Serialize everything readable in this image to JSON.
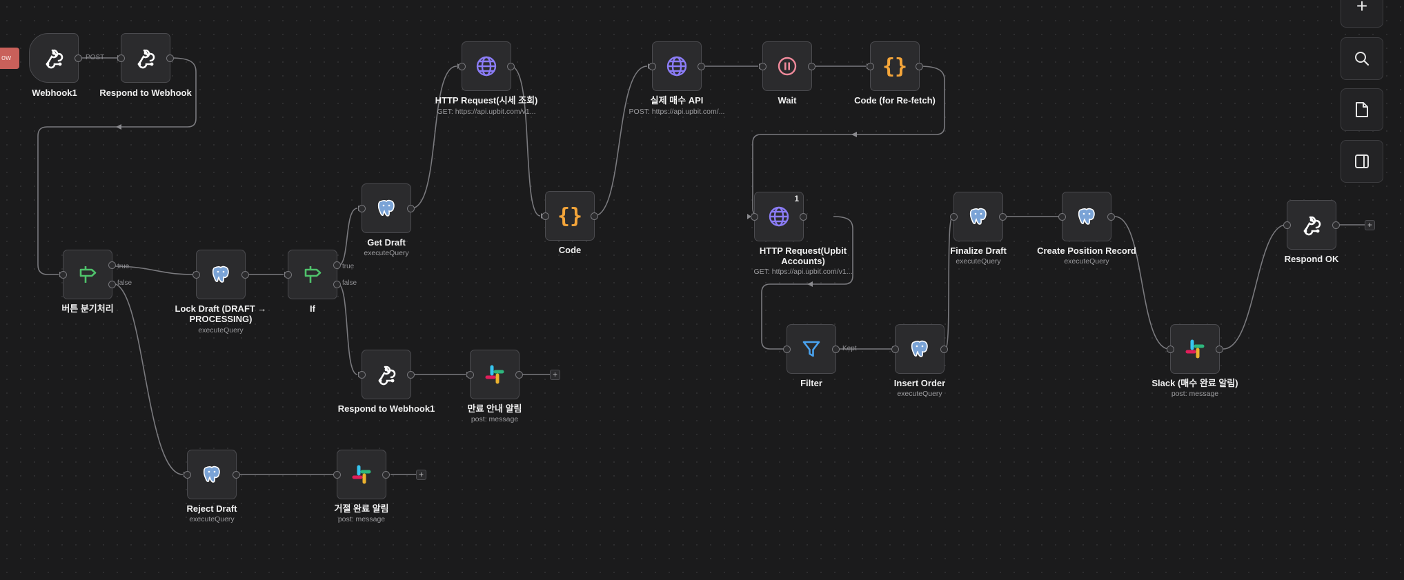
{
  "canvas": {
    "left_tag": "ow"
  },
  "side_controls": [
    {
      "icon": "plus-icon",
      "glyph": "+"
    },
    {
      "icon": "search-icon"
    },
    {
      "icon": "sticky-note-icon"
    },
    {
      "icon": "panel-toggle-icon"
    }
  ],
  "nodes": {
    "webhook1": {
      "label": "Webhook1",
      "icon": "webhook-icon"
    },
    "respond_webhook": {
      "label": "Respond to Webhook",
      "icon": "webhook-icon"
    },
    "http_price": {
      "label": "HTTP Request(시세 조회)",
      "sub": "GET: https://api.upbit.com/v1...",
      "icon": "globe-icon"
    },
    "buy_api": {
      "label": "실제 매수 API",
      "sub": "POST: https://api.upbit.com/...",
      "icon": "globe-icon"
    },
    "wait": {
      "label": "Wait",
      "icon": "pause-icon"
    },
    "code_refetch": {
      "label": "Code (for Re-fetch)",
      "icon": "code-braces-icon"
    },
    "get_draft": {
      "label": "Get Draft",
      "sub": "executeQuery",
      "icon": "postgres-icon"
    },
    "code": {
      "label": "Code",
      "icon": "code-braces-icon"
    },
    "http_accounts": {
      "label": "HTTP Request(Upbit Accounts)",
      "sub": "GET: https://api.upbit.com/v1...",
      "icon": "globe-icon",
      "badge": "1"
    },
    "finalize_draft": {
      "label": "Finalize Draft",
      "sub": "executeQuery",
      "icon": "postgres-icon"
    },
    "create_position": {
      "label": "Create Position Record",
      "sub": "executeQuery",
      "icon": "postgres-icon"
    },
    "respond_ok": {
      "label": "Respond OK",
      "icon": "webhook-icon"
    },
    "button_branch": {
      "label": "버튼 분기처리",
      "icon": "switch-sign-icon"
    },
    "lock_draft": {
      "label": "Lock Draft (DRAFT → PROCESSING)",
      "sub": "executeQuery",
      "icon": "postgres-icon"
    },
    "if_node": {
      "label": "If",
      "icon": "switch-sign-icon"
    },
    "respond_webhook1": {
      "label": "Respond to Webhook1",
      "icon": "webhook-icon"
    },
    "expire_alert": {
      "label": "만료 안내 알림",
      "sub": "post: message",
      "icon": "slack-icon"
    },
    "filter": {
      "label": "Filter",
      "icon": "filter-funnel-icon"
    },
    "insert_order": {
      "label": "Insert Order",
      "sub": "executeQuery",
      "icon": "postgres-icon"
    },
    "slack_buy": {
      "label": "Slack (매수 완료 알림)",
      "sub": "post: message",
      "icon": "slack-icon"
    },
    "reject_draft": {
      "label": "Reject Draft",
      "sub": "executeQuery",
      "icon": "postgres-icon"
    },
    "reject_alert": {
      "label": "거절 완료 알림",
      "sub": "post: message",
      "icon": "slack-icon"
    }
  },
  "edge_labels": {
    "post": "POST",
    "true1": "true",
    "false1": "false",
    "true2": "true",
    "false2": "false",
    "kept": "Kept"
  },
  "colors": {
    "globe": "#8b7cf6",
    "code": "#f4a53a",
    "wait": "#f08a9b",
    "switch": "#4fc26b",
    "filter": "#4aa3f0",
    "postgres": "#7aa3d6",
    "left_tag": "#c9605a"
  }
}
